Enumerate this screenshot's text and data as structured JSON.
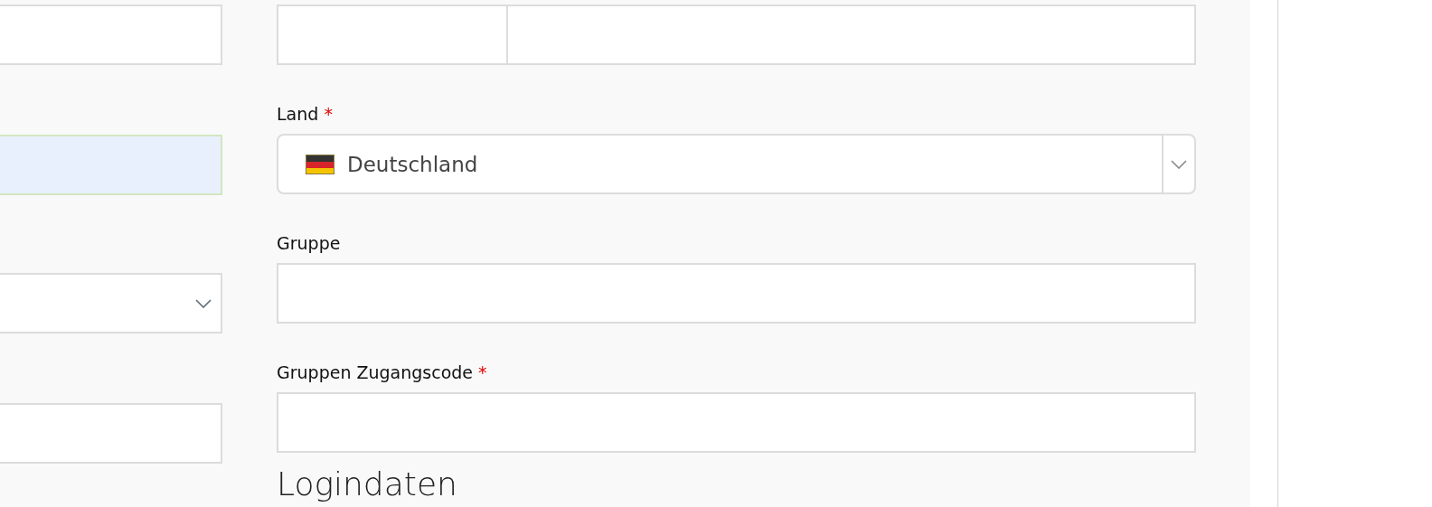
{
  "left_fields": [
    {
      "kind": "text",
      "autofilled": false
    },
    {
      "kind": "text",
      "autofilled": true
    },
    {
      "kind": "select",
      "autofilled": false
    },
    {
      "kind": "text",
      "autofilled": false
    }
  ],
  "right_fields": [
    {
      "kind": "split"
    },
    {
      "kind": "country",
      "label": "Land",
      "required": true,
      "value": "Deutschland"
    },
    {
      "kind": "text",
      "label": "Gruppe",
      "required": false
    },
    {
      "kind": "text",
      "label": "Gruppen Zugangscode",
      "required": true
    }
  ],
  "required_mark": "*",
  "section_heading": "Logindaten"
}
